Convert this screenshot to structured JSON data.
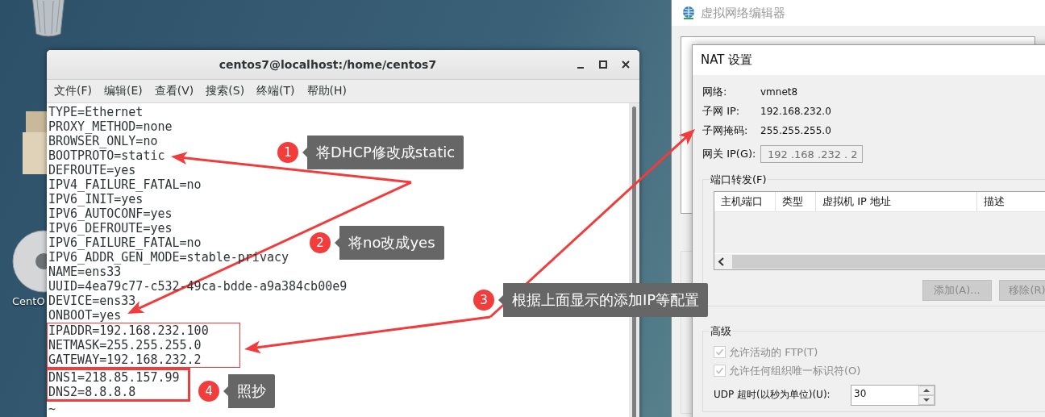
{
  "desktop_icons": [
    {
      "kind": "trash"
    },
    {
      "kind": "folder"
    },
    {
      "kind": "disc",
      "label": "CentO"
    }
  ],
  "terminal": {
    "title": "centos7@localhost:/home/centos7",
    "menu": [
      "文件(F)",
      "编辑(E)",
      "查看(V)",
      "搜索(S)",
      "终端(T)",
      "帮助(H)"
    ],
    "line_groups": [
      {
        "kind": "plain",
        "lines": [
          "TYPE=Ethernet",
          "PROXY_METHOD=none",
          "BROWSER_ONLY=no",
          "BOOTPROTO=static",
          "DEFROUTE=yes",
          "IPV4_FAILURE_FATAL=no",
          "IPV6_INIT=yes",
          "IPV6_AUTOCONF=yes",
          "IPV6_DEFROUTE=yes",
          "IPV6_FAILURE_FATAL=no",
          "IPV6_ADDR_GEN_MODE=stable-privacy",
          "NAME=ens33",
          "UUID=4ea79c77-c532-49ca-bdde-a9a384cb00e9",
          "DEVICE=ens33",
          "ONBOOT=yes"
        ]
      },
      {
        "kind": "thin_box",
        "lines": [
          "IPADDR=192.168.232.100",
          "NETMASK=255.255.255.0",
          "GATEWAY=192.168.232.2"
        ]
      },
      {
        "kind": "thick_box",
        "lines": [
          "DNS1=218.85.157.99",
          "DNS2=8.8.8.8"
        ]
      },
      {
        "kind": "plain",
        "lines": [
          "~"
        ]
      }
    ]
  },
  "editor_window": {
    "title": "虚拟网络编辑器"
  },
  "nat_dialog": {
    "title": "NAT 设置",
    "info": [
      {
        "label": "网络:",
        "value": "vmnet8"
      },
      {
        "label": "子网 IP:",
        "value": "192.168.232.0"
      },
      {
        "label": "子网掩码:",
        "value": "255.255.255.0"
      }
    ],
    "gateway": {
      "label": "网关 IP(G):",
      "value": "192 .168 .232 . 2",
      "disabled": true
    },
    "port_forwarding": {
      "title": "端口转发(F)",
      "columns": [
        "主机端口",
        "类型",
        "虚拟机 IP 地址",
        "描述"
      ],
      "buttons": [
        {
          "label": "添加(A)...",
          "disabled": true
        },
        {
          "label": "移除(R)",
          "disabled": true
        }
      ]
    },
    "advanced": {
      "title": "高级",
      "options": [
        {
          "label": "允许活动的 FTP(T)",
          "checked": true,
          "disabled": true
        },
        {
          "label": "允许任何组织唯一标识符(O)",
          "checked": true,
          "disabled": true
        }
      ],
      "spinners": [
        {
          "label": "UDP 超时(以秒为单位)(U):",
          "value": "30"
        }
      ]
    }
  },
  "annotations": [
    {
      "number": "1",
      "text": "将DHCP修改成static"
    },
    {
      "number": "2",
      "text": "将no改成yes"
    },
    {
      "number": "3",
      "text": "根据上面显示的添加IP等配置"
    },
    {
      "number": "4",
      "text": "照抄"
    }
  ]
}
